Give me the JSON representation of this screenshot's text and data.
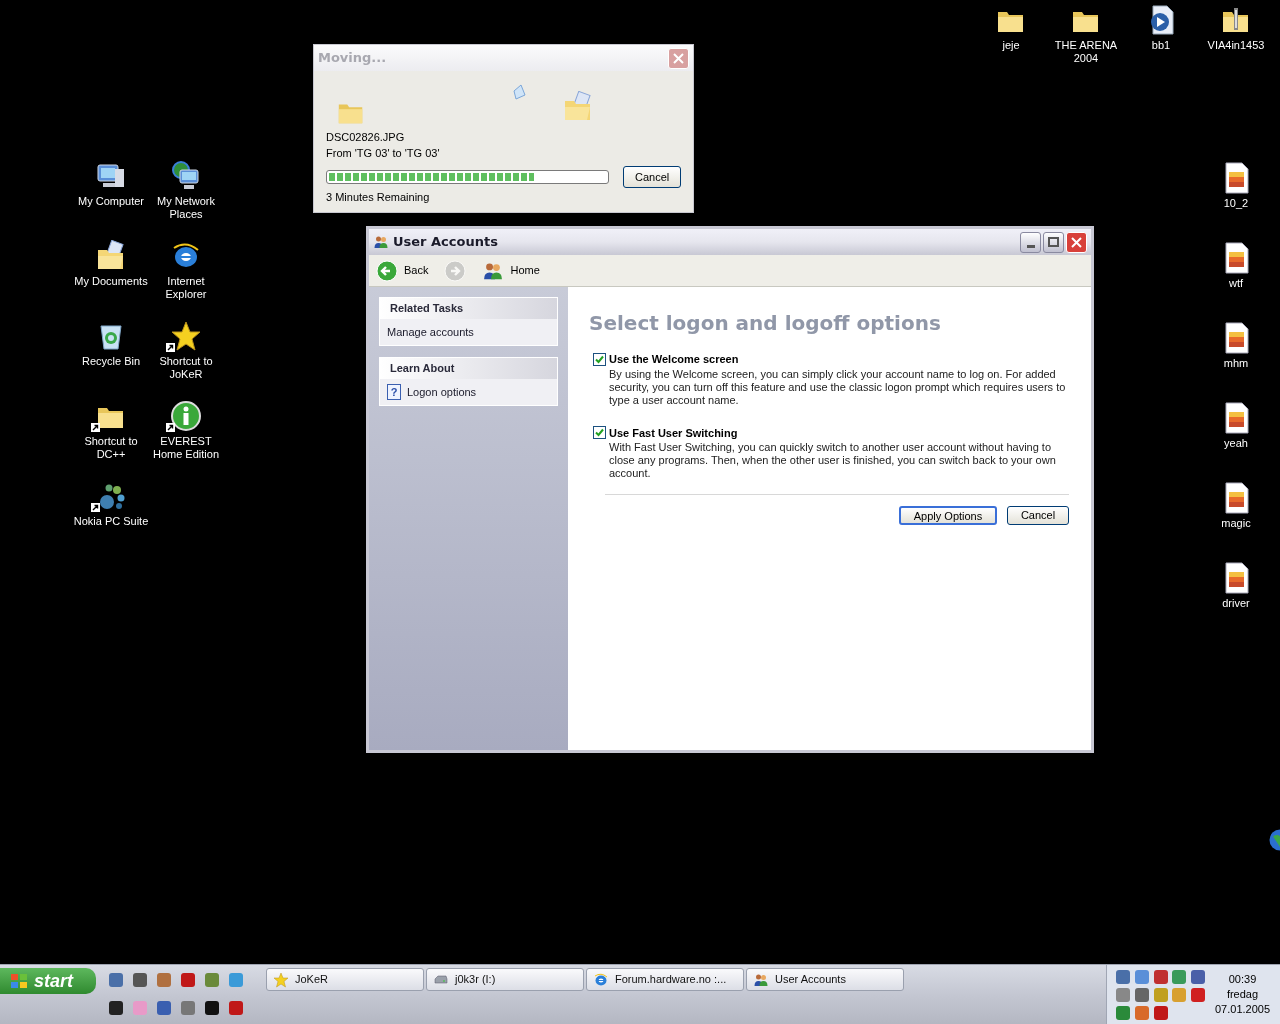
{
  "desktop": {
    "icons": [
      {
        "label": "My Computer",
        "kind": "computer",
        "shortcut": false
      },
      {
        "label": "My Network Places",
        "kind": "network",
        "shortcut": false
      },
      {
        "label": "My Documents",
        "kind": "documents",
        "shortcut": false
      },
      {
        "label": "Internet Explorer",
        "kind": "browser",
        "shortcut": false
      },
      {
        "label": "Recycle Bin",
        "kind": "recycle",
        "shortcut": false
      },
      {
        "label": "Shortcut to JoKeR",
        "kind": "star",
        "shortcut": true
      },
      {
        "label": "Shortcut to DC++",
        "kind": "folder",
        "shortcut": true
      },
      {
        "label": "EVEREST Home Edition",
        "kind": "info",
        "shortcut": true
      },
      {
        "label": "Nokia PC Suite",
        "kind": "nokia",
        "shortcut": true
      },
      {
        "label": "jeje",
        "kind": "folder",
        "shortcut": false
      },
      {
        "label": "THE ARENA 2004",
        "kind": "folder",
        "shortcut": false
      },
      {
        "label": "bb1",
        "kind": "media",
        "shortcut": false
      },
      {
        "label": "VIA4in1453",
        "kind": "zip",
        "shortcut": false
      },
      {
        "label": "10_2",
        "kind": "image",
        "shortcut": false
      },
      {
        "label": "wtf",
        "kind": "image",
        "shortcut": false
      },
      {
        "label": "mhm",
        "kind": "image",
        "shortcut": false
      },
      {
        "label": "yeah",
        "kind": "image",
        "shortcut": false
      },
      {
        "label": "magic",
        "kind": "image",
        "shortcut": false
      },
      {
        "label": "driver",
        "kind": "image",
        "shortcut": false
      }
    ]
  },
  "moving_dialog": {
    "title": "Moving...",
    "active": false,
    "file": "DSC02826.JPG",
    "route": "From 'TG 03' to 'TG 03'",
    "progress": {
      "level": 0.74
    },
    "time_left": "3 Minutes Remaining",
    "button": "Cancel"
  },
  "user_accounts": {
    "title": "User Accounts",
    "active": true,
    "toolbar": [
      {
        "label": "Back",
        "kind": "back",
        "disabled": false
      },
      {
        "kind": "forward",
        "disabled": true
      },
      {
        "label": "Home",
        "kind": "home",
        "disabled": false
      }
    ],
    "sidebar": [
      {
        "title": "Related Tasks",
        "items": [
          {
            "label": "Manage accounts"
          }
        ]
      },
      {
        "title": "Learn About",
        "items": [
          {
            "label": "Logon options",
            "icon": "?"
          }
        ]
      }
    ],
    "heading": "Select logon and logoff options",
    "options": [
      {
        "label": "Use the Welcome screen",
        "checked": true,
        "description": "By using the Welcome screen, you can simply click your account name to log on. For added security, you can turn off this feature and use the classic logon prompt which requires users to type a user account name."
      },
      {
        "label": "Use Fast User Switching",
        "checked": true,
        "description": "With Fast User Switching, you can quickly switch to another user account without having to close any programs. Then, when the other user is finished, you can switch back to your own account."
      }
    ],
    "buttons": [
      {
        "label": "Apply Options",
        "default": true
      },
      {
        "label": "Cancel",
        "default": false
      }
    ]
  },
  "taskbar": {
    "start": "start",
    "tasks": [
      {
        "label": "JoKeR",
        "kind": "star",
        "selected": false
      },
      {
        "label": "j0k3r (I:)",
        "kind": "drive",
        "selected": false
      },
      {
        "label": "Forum.hardware.no :...",
        "kind": "browser",
        "selected": false
      },
      {
        "label": "User Accounts",
        "kind": "users",
        "selected": false
      }
    ],
    "clock": {
      "time": "00:39",
      "day": "fredag",
      "date": "07.01.2005"
    }
  }
}
